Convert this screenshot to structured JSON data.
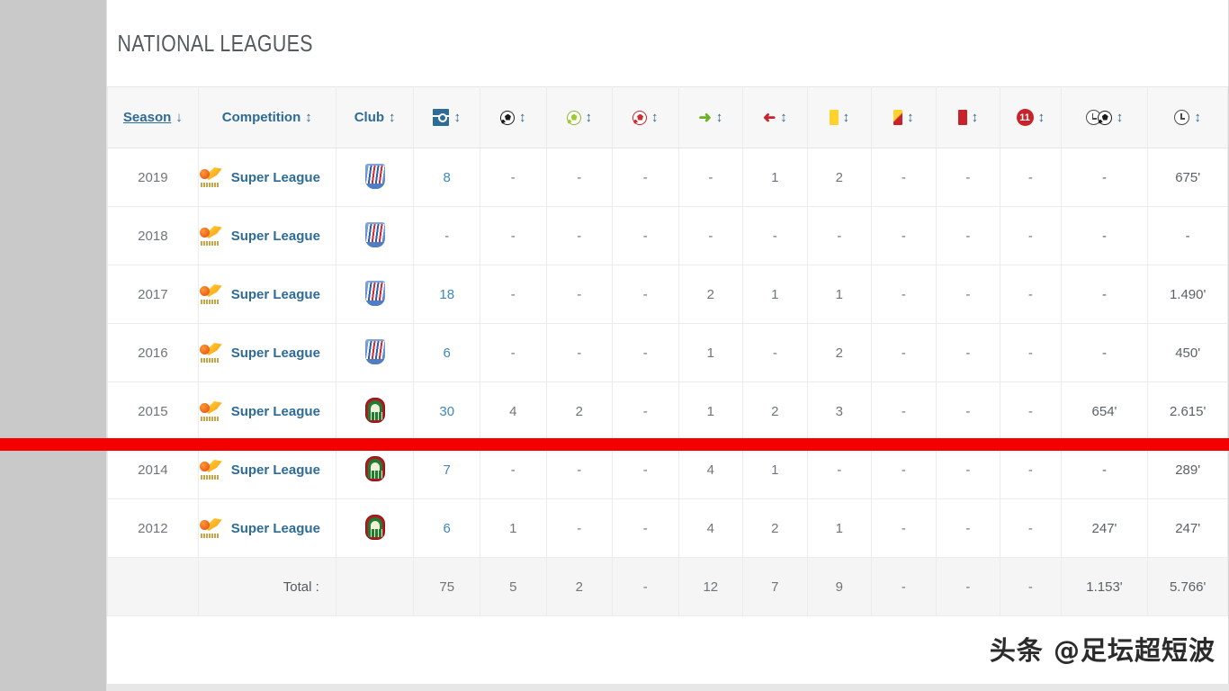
{
  "panel": {
    "title": "NATIONAL LEAGUES"
  },
  "table": {
    "headers": [
      {
        "label": "Season",
        "icon": "",
        "sort": "down",
        "sorted": true
      },
      {
        "label": "Competition",
        "icon": "",
        "sort": "updown",
        "sorted": false
      },
      {
        "label": "Club",
        "icon": "",
        "sort": "updown",
        "sorted": false
      },
      {
        "label": "",
        "icon": "pitch-icon",
        "sort": "updown",
        "sorted": false
      },
      {
        "label": "",
        "icon": "ball-dark-icon",
        "sort": "updown",
        "sorted": false
      },
      {
        "label": "",
        "icon": "ball-green-icon",
        "sort": "updown",
        "sorted": false
      },
      {
        "label": "",
        "icon": "ball-red-icon",
        "sort": "updown",
        "sorted": false
      },
      {
        "label": "",
        "icon": "arrow-in-icon",
        "sort": "updown",
        "sorted": false
      },
      {
        "label": "",
        "icon": "arrow-out-icon",
        "sort": "updown",
        "sorted": false
      },
      {
        "label": "",
        "icon": "yellow-card-icon",
        "sort": "updown",
        "sorted": false
      },
      {
        "label": "",
        "icon": "yellow-red-card-icon",
        "sort": "updown",
        "sorted": false
      },
      {
        "label": "",
        "icon": "red-card-icon",
        "sort": "updown",
        "sorted": false
      },
      {
        "label": "",
        "icon": "eleven-badge-icon",
        "sort": "updown",
        "sorted": false
      },
      {
        "label": "",
        "icon": "clock-ball-icon",
        "sort": "updown",
        "sorted": false
      },
      {
        "label": "",
        "icon": "clock-icon",
        "sort": "updown",
        "sorted": false
      }
    ],
    "sort_glyph_down": "↓",
    "sort_glyph_updown": "↕",
    "rows": [
      {
        "season": "2019",
        "competition": "Super League",
        "club_crest": "blue-striped-crest",
        "appearances": "8",
        "goals": "-",
        "assists": "-",
        "own_goals": "-",
        "subbed_in": "-",
        "subbed_out": "1",
        "yellow": "2",
        "yellow_red": "-",
        "red": "-",
        "starting_eleven": "-",
        "minutes_per_goal": "-",
        "minutes_played": "675'"
      },
      {
        "season": "2018",
        "competition": "Super League",
        "club_crest": "blue-striped-crest",
        "appearances": "-",
        "goals": "-",
        "assists": "-",
        "own_goals": "-",
        "subbed_in": "-",
        "subbed_out": "-",
        "yellow": "-",
        "yellow_red": "-",
        "red": "-",
        "starting_eleven": "-",
        "minutes_per_goal": "-",
        "minutes_played": "-"
      },
      {
        "season": "2017",
        "competition": "Super League",
        "club_crest": "blue-striped-crest",
        "appearances": "18",
        "goals": "-",
        "assists": "-",
        "own_goals": "-",
        "subbed_in": "2",
        "subbed_out": "1",
        "yellow": "1",
        "yellow_red": "-",
        "red": "-",
        "starting_eleven": "-",
        "minutes_per_goal": "-",
        "minutes_played": "1.490'"
      },
      {
        "season": "2016",
        "competition": "Super League",
        "club_crest": "blue-striped-crest",
        "appearances": "6",
        "goals": "-",
        "assists": "-",
        "own_goals": "-",
        "subbed_in": "1",
        "subbed_out": "-",
        "yellow": "2",
        "yellow_red": "-",
        "red": "-",
        "starting_eleven": "-",
        "minutes_per_goal": "-",
        "minutes_played": "450'"
      },
      {
        "season": "2015",
        "competition": "Super League",
        "club_crest": "green-red-crest",
        "appearances": "30",
        "goals": "4",
        "assists": "2",
        "own_goals": "-",
        "subbed_in": "1",
        "subbed_out": "2",
        "yellow": "3",
        "yellow_red": "-",
        "red": "-",
        "starting_eleven": "-",
        "minutes_per_goal": "654'",
        "minutes_played": "2.615'"
      },
      {
        "season": "2014",
        "competition": "Super League",
        "club_crest": "green-red-crest",
        "appearances": "7",
        "goals": "-",
        "assists": "-",
        "own_goals": "-",
        "subbed_in": "4",
        "subbed_out": "1",
        "yellow": "-",
        "yellow_red": "-",
        "red": "-",
        "starting_eleven": "-",
        "minutes_per_goal": "-",
        "minutes_played": "289'"
      },
      {
        "season": "2012",
        "competition": "Super League",
        "club_crest": "green-red-crest",
        "appearances": "6",
        "goals": "1",
        "assists": "-",
        "own_goals": "-",
        "subbed_in": "4",
        "subbed_out": "2",
        "yellow": "1",
        "yellow_red": "-",
        "red": "-",
        "starting_eleven": "-",
        "minutes_per_goal": "247'",
        "minutes_played": "247'"
      }
    ],
    "totals": {
      "label": "Total :",
      "appearances": "75",
      "goals": "5",
      "assists": "2",
      "own_goals": "-",
      "subbed_in": "12",
      "subbed_out": "7",
      "yellow": "9",
      "yellow_red": "-",
      "red": "-",
      "starting_eleven": "-",
      "minutes_per_goal": "1.153'",
      "minutes_played": "5.766'"
    }
  },
  "annotation": {
    "red_bar_color": "#f50000"
  },
  "watermark": {
    "text": "头条 @足坛超短波"
  },
  "colors": {
    "page_background": "#c9c9c9",
    "card_background": "#ffffff",
    "header_background": "#f7f7f7",
    "link_blue": "#2e6b96",
    "value_gray": "#6f757a",
    "totals_background": "#f5f5f5"
  }
}
